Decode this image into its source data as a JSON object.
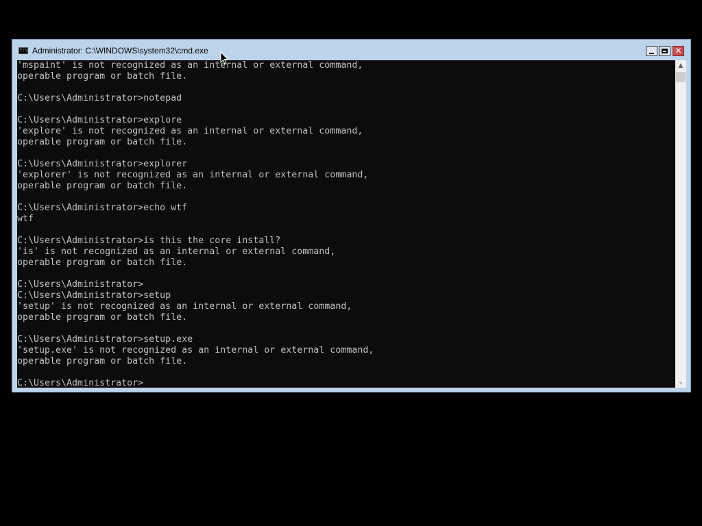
{
  "window": {
    "title": "Administrator: C:\\WINDOWS\\system32\\cmd.exe",
    "icon": "cmd-icon",
    "icon_text": "C:\\",
    "controls": {
      "minimize": "minimize-icon",
      "maximize": "maximize-icon",
      "close": "close-icon",
      "close_glyph": "✕"
    }
  },
  "console": {
    "lines": [
      "'mspaint' is not recognized as an internal or external command,",
      "operable program or batch file.",
      "",
      "C:\\Users\\Administrator>notepad",
      "",
      "C:\\Users\\Administrator>explore",
      "'explore' is not recognized as an internal or external command,",
      "operable program or batch file.",
      "",
      "C:\\Users\\Administrator>explorer",
      "'explorer' is not recognized as an internal or external command,",
      "operable program or batch file.",
      "",
      "C:\\Users\\Administrator>echo wtf",
      "wtf",
      "",
      "C:\\Users\\Administrator>is this the core install?",
      "'is' is not recognized as an internal or external command,",
      "operable program or batch file.",
      "",
      "C:\\Users\\Administrator>",
      "C:\\Users\\Administrator>setup",
      "'setup' is not recognized as an internal or external command,",
      "operable program or batch file.",
      "",
      "C:\\Users\\Administrator>setup.exe",
      "'setup.exe' is not recognized as an internal or external command,",
      "operable program or batch file.",
      "",
      "C:\\Users\\Administrator>"
    ]
  },
  "scrollbar": {
    "up_glyph": "▲",
    "down_glyph": "⌄"
  },
  "colors": {
    "console_bg": "#0c0c0c",
    "console_fg": "#c0c0c0",
    "titlebar": "#bdd3ea",
    "close_button": "#c75050"
  }
}
